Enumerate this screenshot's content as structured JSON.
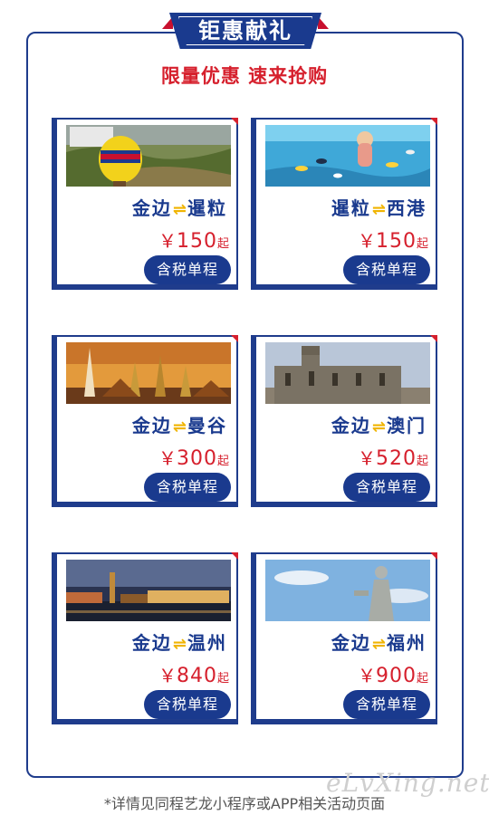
{
  "header": {
    "title": "钜惠献礼",
    "subtitle": "限量优惠 速来抢购"
  },
  "colors": {
    "brand_blue": "#1a3a8e",
    "accent_red": "#d6202d",
    "arrow_yellow": "#f0b400"
  },
  "cards": [
    {
      "from": "金边",
      "to": "暹粒",
      "arrow": "⇌",
      "currency": "￥",
      "price": "150",
      "suffix": "起",
      "button": "含税单程",
      "photo": "balloon-over-angkor"
    },
    {
      "from": "暹粒",
      "to": "西港",
      "arrow": "⇌",
      "currency": "￥",
      "price": "150",
      "suffix": "起",
      "button": "含税单程",
      "photo": "snorkeling-tropical-sea"
    },
    {
      "from": "金边",
      "to": "曼谷",
      "arrow": "⇌",
      "currency": "￥",
      "price": "300",
      "suffix": "起",
      "button": "含税单程",
      "photo": "bangkok-temples-sunset"
    },
    {
      "from": "金边",
      "to": "澳门",
      "arrow": "⇌",
      "currency": "￥",
      "price": "520",
      "suffix": "起",
      "button": "含税单程",
      "photo": "ruins-of-st-pauls"
    },
    {
      "from": "金边",
      "to": "温州",
      "arrow": "⇌",
      "currency": "￥",
      "price": "840",
      "suffix": "起",
      "button": "含税单程",
      "photo": "wenzhou-riverside-night"
    },
    {
      "from": "金边",
      "to": "福州",
      "arrow": "⇌",
      "currency": "￥",
      "price": "900",
      "suffix": "起",
      "button": "含税单程",
      "photo": "guanyin-statue"
    }
  ],
  "footer": {
    "note": "*详情见同程艺龙小程序或APP相关活动页面"
  },
  "watermark": "eLvXing.net"
}
